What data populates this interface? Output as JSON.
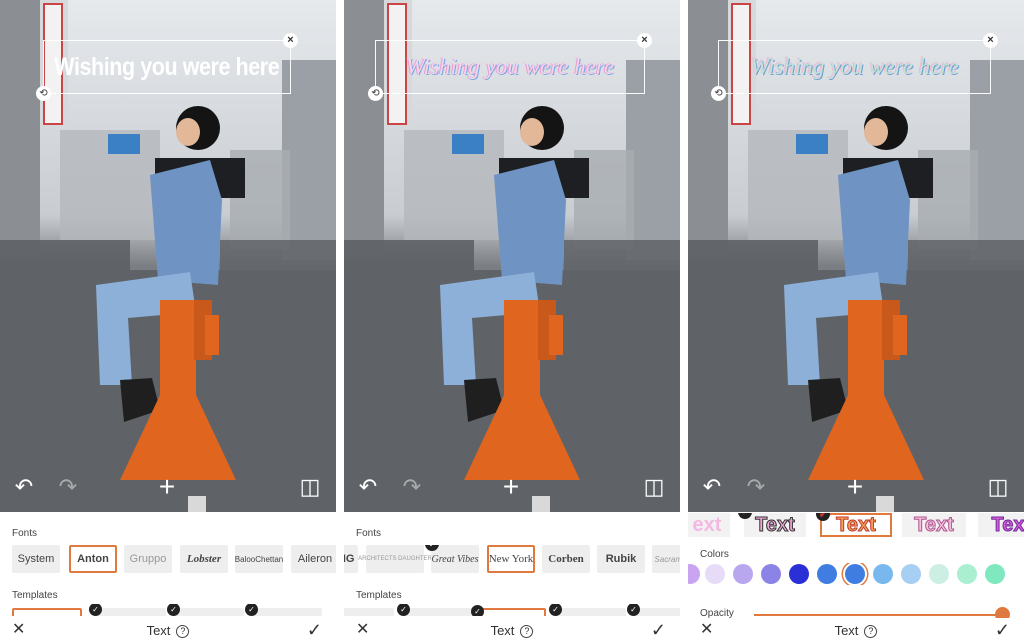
{
  "caption_text": "Wishing you were here",
  "accent_color": "#e0793e",
  "icons": {
    "close": "close-icon",
    "rotate_handle": "rotate-handle-icon",
    "undo": "undo-icon",
    "redo": "redo-icon",
    "add": "plus-icon",
    "compare": "compare-icon",
    "help": "help-icon",
    "apply": "checkmark-icon"
  },
  "glyphs": {
    "close": "×",
    "handle": "⟲",
    "undo": "↶",
    "redo": "↷",
    "add": "+",
    "compare": "◫",
    "cancel": "✕",
    "help": "?",
    "apply": "✓",
    "check": "✓"
  },
  "bottom_bar": {
    "title": "Text"
  },
  "panel1": {
    "fonts_label": "Fonts",
    "templates_label": "Templates",
    "fonts": [
      "System",
      "Anton",
      "Gruppo",
      "Lobster",
      "BalooChettan",
      "Aileron"
    ],
    "selected_font": "Anton"
  },
  "panel2": {
    "fonts_label": "Fonts",
    "templates_label": "Templates",
    "fonts": [
      "XING",
      "ARCHITECTS DAUGHTER",
      "Great Vibes",
      "New York",
      "Corben",
      "Rubik",
      "Sacramento"
    ],
    "selected_font": "New York"
  },
  "panel3": {
    "colors_label": "Colors",
    "opacity_label": "Opacity",
    "styles": [
      "ext",
      "Text",
      "Text",
      "Text",
      "Tex"
    ],
    "selected_style_index": 2,
    "swatches": [
      "#c9a4f0",
      "#e6dcf7",
      "#b8a7ef",
      "#8c83e6",
      "#2b2fd6",
      "#3f7ee0",
      "#3f7ee0",
      "#78b8ee",
      "#a6cff3",
      "#cdeee3",
      "#a9efd0",
      "#7fe8bf"
    ],
    "selected_swatch_index": 6,
    "opacity_value": 100
  }
}
